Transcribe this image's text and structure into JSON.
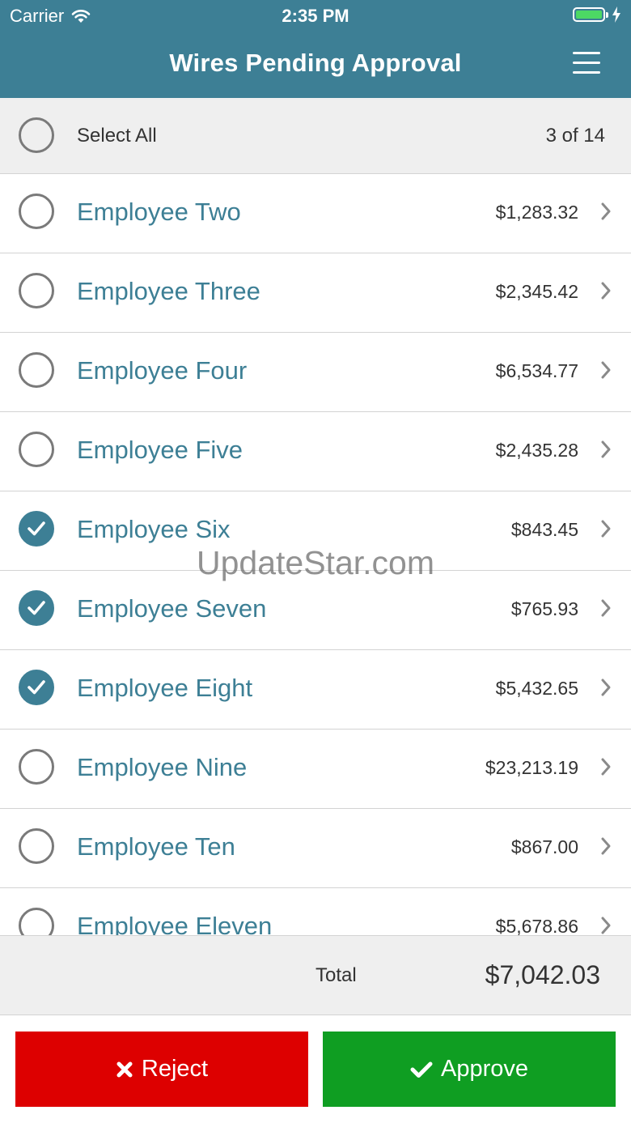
{
  "status_bar": {
    "carrier": "Carrier",
    "time": "2:35 PM"
  },
  "nav": {
    "title": "Wires Pending Approval"
  },
  "select_all": {
    "label": "Select All",
    "count": "3 of 14"
  },
  "rows": [
    {
      "name": "Employee Two",
      "amount": "$1,283.32",
      "checked": false
    },
    {
      "name": "Employee Three",
      "amount": "$2,345.42",
      "checked": false
    },
    {
      "name": "Employee Four",
      "amount": "$6,534.77",
      "checked": false
    },
    {
      "name": "Employee Five",
      "amount": "$2,435.28",
      "checked": false
    },
    {
      "name": "Employee Six",
      "amount": "$843.45",
      "checked": true
    },
    {
      "name": "Employee Seven",
      "amount": "$765.93",
      "checked": true
    },
    {
      "name": "Employee Eight",
      "amount": "$5,432.65",
      "checked": true
    },
    {
      "name": "Employee Nine",
      "amount": "$23,213.19",
      "checked": false
    },
    {
      "name": "Employee Ten",
      "amount": "$867.00",
      "checked": false
    },
    {
      "name": "Employee Eleven",
      "amount": "$5,678.86",
      "checked": false
    }
  ],
  "total": {
    "label": "Total",
    "value": "$7,042.03"
  },
  "actions": {
    "reject_label": "Reject",
    "approve_label": "Approve"
  },
  "watermark": "UpdateStar.com",
  "colors": {
    "header": "#3d7f95",
    "reject": "#dd0000",
    "approve": "#0f9e22",
    "battery": "#4cd964"
  }
}
